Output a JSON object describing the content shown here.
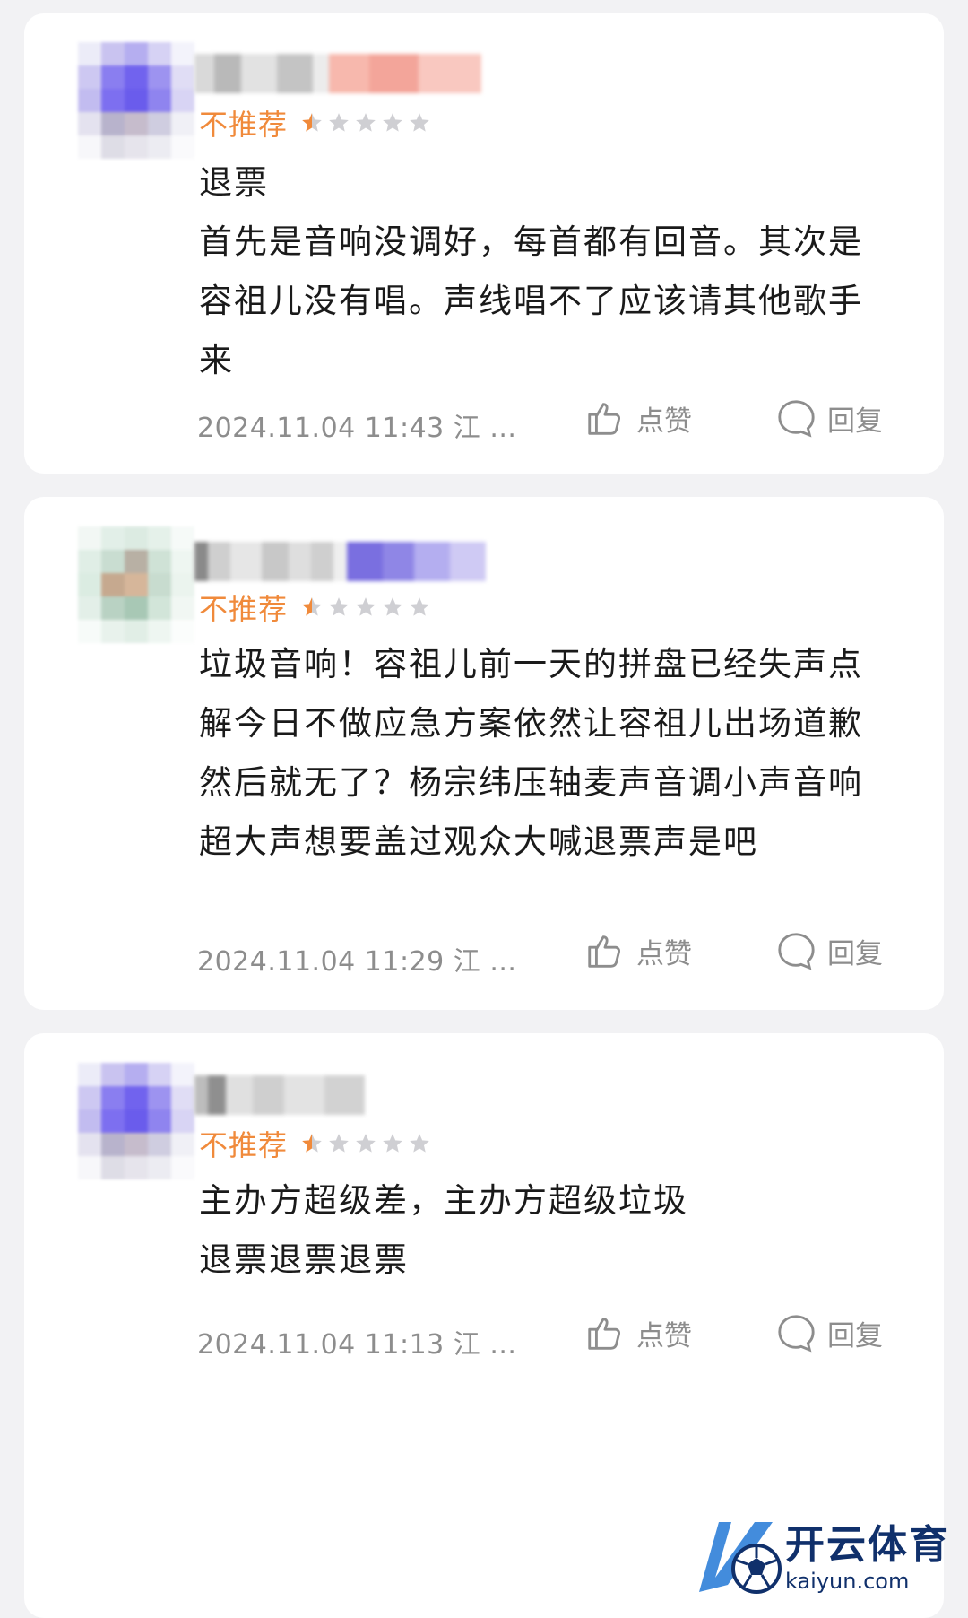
{
  "colors": {
    "accent": "#f08a3b",
    "text": "#1a1a1a",
    "muted": "#8d8d8d",
    "card": "#ffffff",
    "background": "#f2f2f4",
    "star_off": "#cfcfd3"
  },
  "reviews": [
    {
      "rating_label": "不推荐",
      "stars": 0.5,
      "content": [
        "退票",
        "首先是音响没调好，每首都有回音。其次是容祖儿没有唱。声线唱不了应该请其他歌手来"
      ],
      "meta": "2024.11.04 11:43 江 ...",
      "like_label": "点赞",
      "reply_label": "回复"
    },
    {
      "rating_label": "不推荐",
      "stars": 0.5,
      "content": [
        "垃圾音响！容祖儿前一天的拼盘已经失声点解今日不做应急方案依然让容祖儿出场道歉然后就无了？杨宗纬压轴麦声音调小声音响超大声想要盖过观众大喊退票声是吧"
      ],
      "meta": "2024.11.04 11:29 江 ...",
      "like_label": "点赞",
      "reply_label": "回复"
    },
    {
      "rating_label": "不推荐",
      "stars": 0.5,
      "content": [
        "主办方超级差，主办方超级垃圾",
        "退票退票退票"
      ],
      "meta": "2024.11.04 11:13 江 ...",
      "like_label": "点赞",
      "reply_label": "回复"
    }
  ],
  "watermark": {
    "name": "开云体育",
    "domain": "kaiyun.com"
  }
}
